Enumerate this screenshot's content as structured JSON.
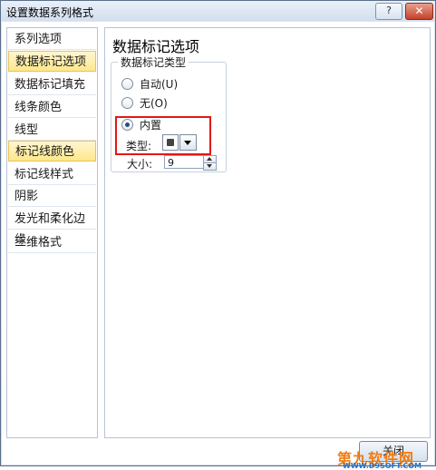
{
  "window": {
    "title": "设置数据系列格式",
    "help_label": "?",
    "close_label": "✕"
  },
  "sidebar": {
    "items": [
      {
        "label": "系列选项",
        "selected": false
      },
      {
        "label": "数据标记选项",
        "selected": true
      },
      {
        "label": "数据标记填充",
        "selected": false
      },
      {
        "label": "线条颜色",
        "selected": false
      },
      {
        "label": "线型",
        "selected": false
      },
      {
        "label": "标记线颜色",
        "selected": true
      },
      {
        "label": "标记线样式",
        "selected": false
      },
      {
        "label": "阴影",
        "selected": false
      },
      {
        "label": "发光和柔化边缘",
        "selected": false
      },
      {
        "label": "三维格式",
        "selected": false
      }
    ]
  },
  "main": {
    "section_title": "数据标记选项",
    "group_title": "数据标记类型",
    "options": [
      {
        "label": "自动(U)",
        "checked": false
      },
      {
        "label": "无(O)",
        "checked": false
      },
      {
        "label": "内置",
        "checked": true
      }
    ],
    "type_label": "类型:",
    "size_label": "大小:",
    "size_value": "9"
  },
  "footer": {
    "close_button": "关闭"
  },
  "watermark": {
    "text": "第九软件网",
    "url": "WWW.D9SOFT.COM"
  },
  "colors": {
    "highlight": "#e01818",
    "selected_bg": "#ffe78c",
    "watermark": "#f07c13"
  }
}
